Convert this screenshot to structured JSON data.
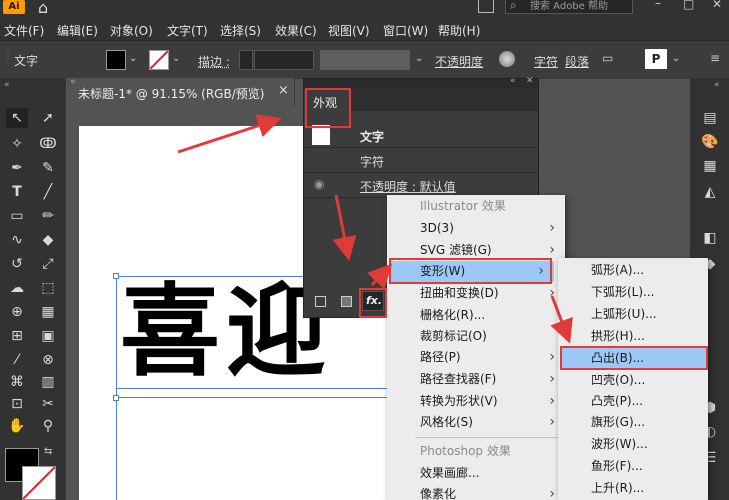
{
  "app": {
    "logo": "Ai"
  },
  "menubar": {
    "items": [
      "文件(F)",
      "编辑(E)",
      "对象(O)",
      "文字(T)",
      "选择(S)",
      "效果(C)",
      "视图(V)",
      "窗口(W)",
      "帮助(H)"
    ],
    "search_placeholder": "搜索 Adobe 帮助"
  },
  "control_bar": {
    "tool_label": "文字",
    "stroke_label": "描边 :",
    "opacity_label": "不透明度",
    "char_label": "字符",
    "para_label": "段落"
  },
  "document": {
    "tab_title": "未标题-1* @ 91.15% (RGB/预览)",
    "close": "×",
    "text": "喜迎"
  },
  "appearance_panel": {
    "title": "外观",
    "rows": [
      "文字",
      "字符",
      "不透明度 : 默认值"
    ],
    "fx_label": "fx."
  },
  "effect_menu": {
    "sections": [
      {
        "header": "Illustrator 效果",
        "items": [
          {
            "label": "3D(3)",
            "sub": true
          },
          {
            "label": "SVG 滤镜(G)",
            "sub": true
          },
          {
            "label": "变形(W)",
            "sub": true,
            "highlighted": true
          },
          {
            "label": "扭曲和变换(D)",
            "sub": true
          },
          {
            "label": "栅格化(R)...",
            "sub": false
          },
          {
            "label": "裁剪标记(O)",
            "sub": false
          },
          {
            "label": "路径(P)",
            "sub": true
          },
          {
            "label": "路径查找器(F)",
            "sub": true
          },
          {
            "label": "转换为形状(V)",
            "sub": true
          },
          {
            "label": "风格化(S)",
            "sub": true
          }
        ]
      },
      {
        "header": "Photoshop 效果",
        "items": [
          {
            "label": "效果画廊...",
            "sub": false
          },
          {
            "label": "像素化",
            "sub": true
          }
        ]
      }
    ]
  },
  "warp_submenu": {
    "items": [
      "弧形(A)...",
      "下弧形(L)...",
      "上弧形(U)...",
      "拱形(H)...",
      "凸出(B)...",
      "凹壳(O)...",
      "凸壳(P)...",
      "旗形(G)...",
      "波形(W)...",
      "鱼形(F)...",
      "上升(R)..."
    ],
    "highlighted_index": 4
  },
  "colors": {
    "highlight": "#9cc8f5",
    "annotation_red": "#e23a3a",
    "ai_orange": "#ff9a00"
  }
}
